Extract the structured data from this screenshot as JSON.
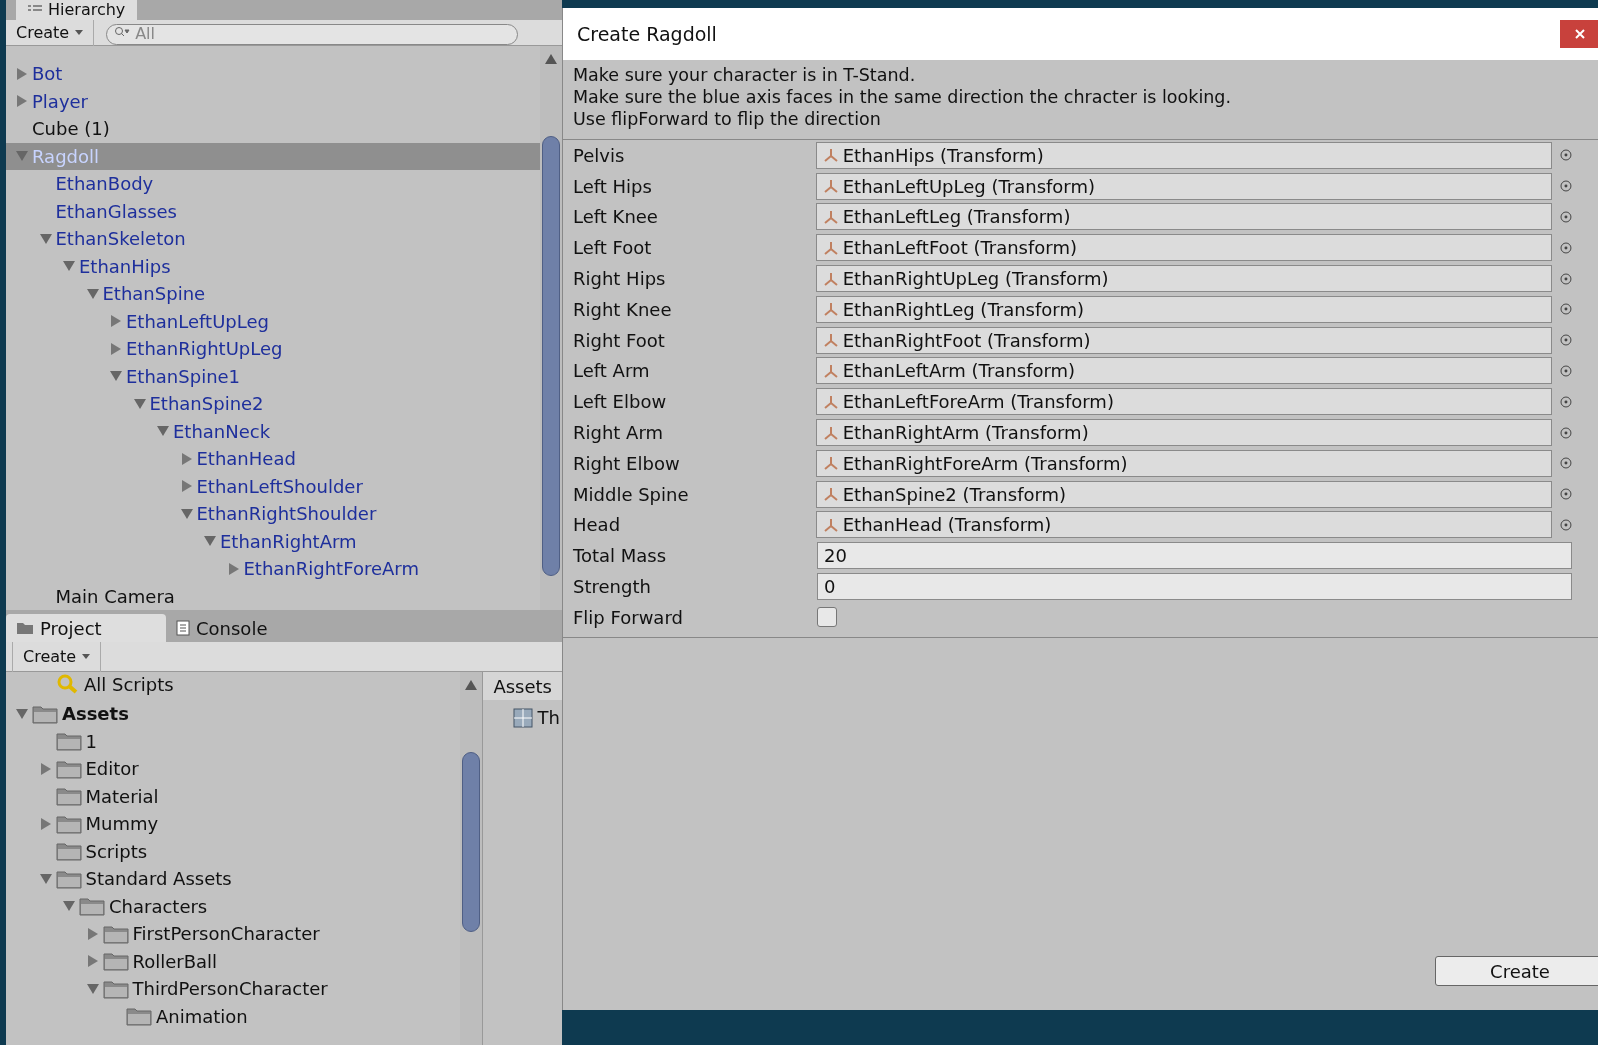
{
  "hierarchy": {
    "tab": "Hierarchy",
    "create_button": "Create",
    "search": {
      "placeholder": "All"
    },
    "items": [
      {
        "label": "Bot",
        "prefab": true,
        "expanded": false,
        "selected": false
      },
      {
        "label": "Player",
        "prefab": true,
        "expanded": false,
        "selected": false
      },
      {
        "label": "Cube (1)",
        "prefab": false,
        "selected": false
      },
      {
        "label": "Ragdoll",
        "prefab": true,
        "expanded": true,
        "selected": true,
        "children": [
          {
            "label": "EthanBody",
            "prefab": true,
            "selected": false
          },
          {
            "label": "EthanGlasses",
            "prefab": true,
            "selected": false
          },
          {
            "label": "EthanSkeleton",
            "prefab": true,
            "expanded": true,
            "selected": false,
            "children": [
              {
                "label": "EthanHips",
                "prefab": true,
                "expanded": true,
                "selected": false,
                "children": [
                  {
                    "label": "EthanSpine",
                    "prefab": true,
                    "expanded": true,
                    "selected": false,
                    "children": [
                      {
                        "label": "EthanLeftUpLeg",
                        "prefab": true,
                        "expanded": false,
                        "selected": false
                      },
                      {
                        "label": "EthanRightUpLeg",
                        "prefab": true,
                        "expanded": false,
                        "selected": false
                      },
                      {
                        "label": "EthanSpine1",
                        "prefab": true,
                        "expanded": true,
                        "selected": false,
                        "children": [
                          {
                            "label": "EthanSpine2",
                            "prefab": true,
                            "expanded": true,
                            "selected": false,
                            "children": [
                              {
                                "label": "EthanNeck",
                                "prefab": true,
                                "expanded": true,
                                "selected": false,
                                "children": [
                                  {
                                    "label": "EthanHead",
                                    "prefab": true,
                                    "expanded": false,
                                    "selected": false
                                  },
                                  {
                                    "label": "EthanLeftShoulder",
                                    "prefab": true,
                                    "expanded": false,
                                    "selected": false
                                  },
                                  {
                                    "label": "EthanRightShoulder",
                                    "prefab": true,
                                    "expanded": true,
                                    "selected": false,
                                    "children": [
                                      {
                                        "label": "EthanRightArm",
                                        "prefab": true,
                                        "expanded": true,
                                        "selected": false,
                                        "children": [
                                          {
                                            "label": "EthanRightForeArm",
                                            "prefab": true,
                                            "expanded": false,
                                            "selected": false
                                          }
                                        ]
                                      }
                                    ]
                                  }
                                ]
                              }
                            ]
                          }
                        ]
                      }
                    ]
                  }
                ]
              }
            ]
          },
          {
            "label": "Main Camera",
            "prefab": false,
            "selected": false
          }
        ]
      }
    ]
  },
  "project": {
    "tabs": [
      {
        "label": "Project",
        "selected": true
      },
      {
        "label": "Console",
        "selected": false
      }
    ],
    "create_button": "Create",
    "favorite": "All Scripts",
    "items": [
      {
        "label": "Assets",
        "bold": true,
        "expanded": true,
        "children": [
          {
            "label": "1",
            "bold": false
          },
          {
            "label": "Editor",
            "bold": false,
            "expanded": false
          },
          {
            "label": "Material",
            "bold": false
          },
          {
            "label": "Mummy",
            "bold": false,
            "expanded": false
          },
          {
            "label": "Scripts",
            "bold": false
          },
          {
            "label": "Standard Assets",
            "bold": false,
            "expanded": true,
            "children": [
              {
                "label": "Characters",
                "bold": false,
                "expanded": true,
                "children": [
                  {
                    "label": "FirstPersonCharacter",
                    "bold": false,
                    "expanded": false
                  },
                  {
                    "label": "RollerBall",
                    "bold": false,
                    "expanded": false
                  },
                  {
                    "label": "ThirdPersonCharacter",
                    "bold": false,
                    "expanded": true,
                    "children": [
                      {
                        "label": "Animation",
                        "bold": false
                      }
                    ]
                  }
                ]
              }
            ]
          }
        ]
      }
    ],
    "breadcrumb": "Assets",
    "grid_item": "Th"
  },
  "dialog": {
    "title": "Create Ragdoll",
    "info": [
      "Make sure your character is in T-Stand.",
      "Make sure the blue axis faces in the same direction the chracter is looking.",
      "Use flipForward to flip the direction"
    ],
    "fields": [
      {
        "label": "Pelvis",
        "kind": "object",
        "value": "EthanHips (Transform)"
      },
      {
        "label": "Left Hips",
        "kind": "object",
        "value": "EthanLeftUpLeg (Transform)"
      },
      {
        "label": "Left Knee",
        "kind": "object",
        "value": "EthanLeftLeg (Transform)"
      },
      {
        "label": "Left Foot",
        "kind": "object",
        "value": "EthanLeftFoot (Transform)"
      },
      {
        "label": "Right Hips",
        "kind": "object",
        "value": "EthanRightUpLeg (Transform)"
      },
      {
        "label": "Right Knee",
        "kind": "object",
        "value": "EthanRightLeg (Transform)"
      },
      {
        "label": "Right Foot",
        "kind": "object",
        "value": "EthanRightFoot (Transform)"
      },
      {
        "label": "Left Arm",
        "kind": "object",
        "value": "EthanLeftArm (Transform)"
      },
      {
        "label": "Left Elbow",
        "kind": "object",
        "value": "EthanLeftForeArm (Transform)"
      },
      {
        "label": "Right Arm",
        "kind": "object",
        "value": "EthanRightArm (Transform)"
      },
      {
        "label": "Right Elbow",
        "kind": "object",
        "value": "EthanRightForeArm (Transform)"
      },
      {
        "label": "Middle Spine",
        "kind": "object",
        "value": "EthanSpine2 (Transform)"
      },
      {
        "label": "Head",
        "kind": "object",
        "value": "EthanHead (Transform)"
      },
      {
        "label": "Total Mass",
        "kind": "number",
        "value": "20"
      },
      {
        "label": "Strength",
        "kind": "number",
        "value": "0"
      },
      {
        "label": "Flip Forward",
        "kind": "checkbox",
        "checked": false
      }
    ],
    "create_button": "Create"
  }
}
